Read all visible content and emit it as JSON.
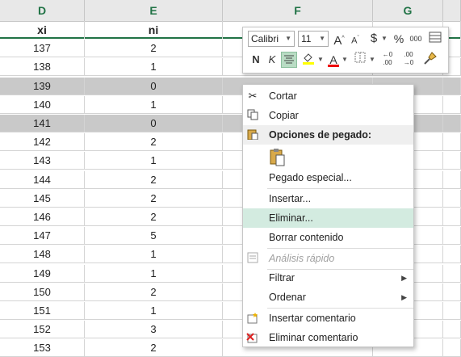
{
  "columns": [
    "D",
    "E",
    "F",
    "G"
  ],
  "header_row": {
    "d": "xi",
    "e": "ni"
  },
  "rows": [
    {
      "xi": "137",
      "ni": "2"
    },
    {
      "xi": "138",
      "ni": "1"
    },
    {
      "xi": "139",
      "ni": "0"
    },
    {
      "xi": "140",
      "ni": "1"
    },
    {
      "xi": "141",
      "ni": "0"
    },
    {
      "xi": "142",
      "ni": "2"
    },
    {
      "xi": "143",
      "ni": "1"
    },
    {
      "xi": "144",
      "ni": "2"
    },
    {
      "xi": "145",
      "ni": "2"
    },
    {
      "xi": "146",
      "ni": "2"
    },
    {
      "xi": "147",
      "ni": "5"
    },
    {
      "xi": "148",
      "ni": "1"
    },
    {
      "xi": "149",
      "ni": "1"
    },
    {
      "xi": "150",
      "ni": "2"
    },
    {
      "xi": "151",
      "ni": "1"
    },
    {
      "xi": "152",
      "ni": "3"
    },
    {
      "xi": "153",
      "ni": "2"
    }
  ],
  "selected_rows": [
    "139",
    "141"
  ],
  "mini_toolbar": {
    "font": "Calibri",
    "size": "11",
    "grow": "A",
    "shrink": "A",
    "currency": "$",
    "percent": "%",
    "thousands": "000",
    "bold": "N",
    "italic": "K",
    "font_color": "A",
    "inc_decimal": "←0 .00",
    "dec_decimal": ".00 →0"
  },
  "context_menu": {
    "cut": "Cortar",
    "copy": "Copiar",
    "paste_options": "Opciones de pegado:",
    "paste_special": "Pegado especial...",
    "insert": "Insertar...",
    "delete": "Eliminar...",
    "clear": "Borrar contenido",
    "quick_analysis": "Análisis rápido",
    "filter": "Filtrar",
    "sort": "Ordenar",
    "insert_comment": "Insertar comentario",
    "delete_comment": "Eliminar comentario"
  },
  "colors": {
    "header_green": "#217346",
    "row_selected": "#c9c9c9",
    "menu_highlight": "#d3ebe0"
  }
}
